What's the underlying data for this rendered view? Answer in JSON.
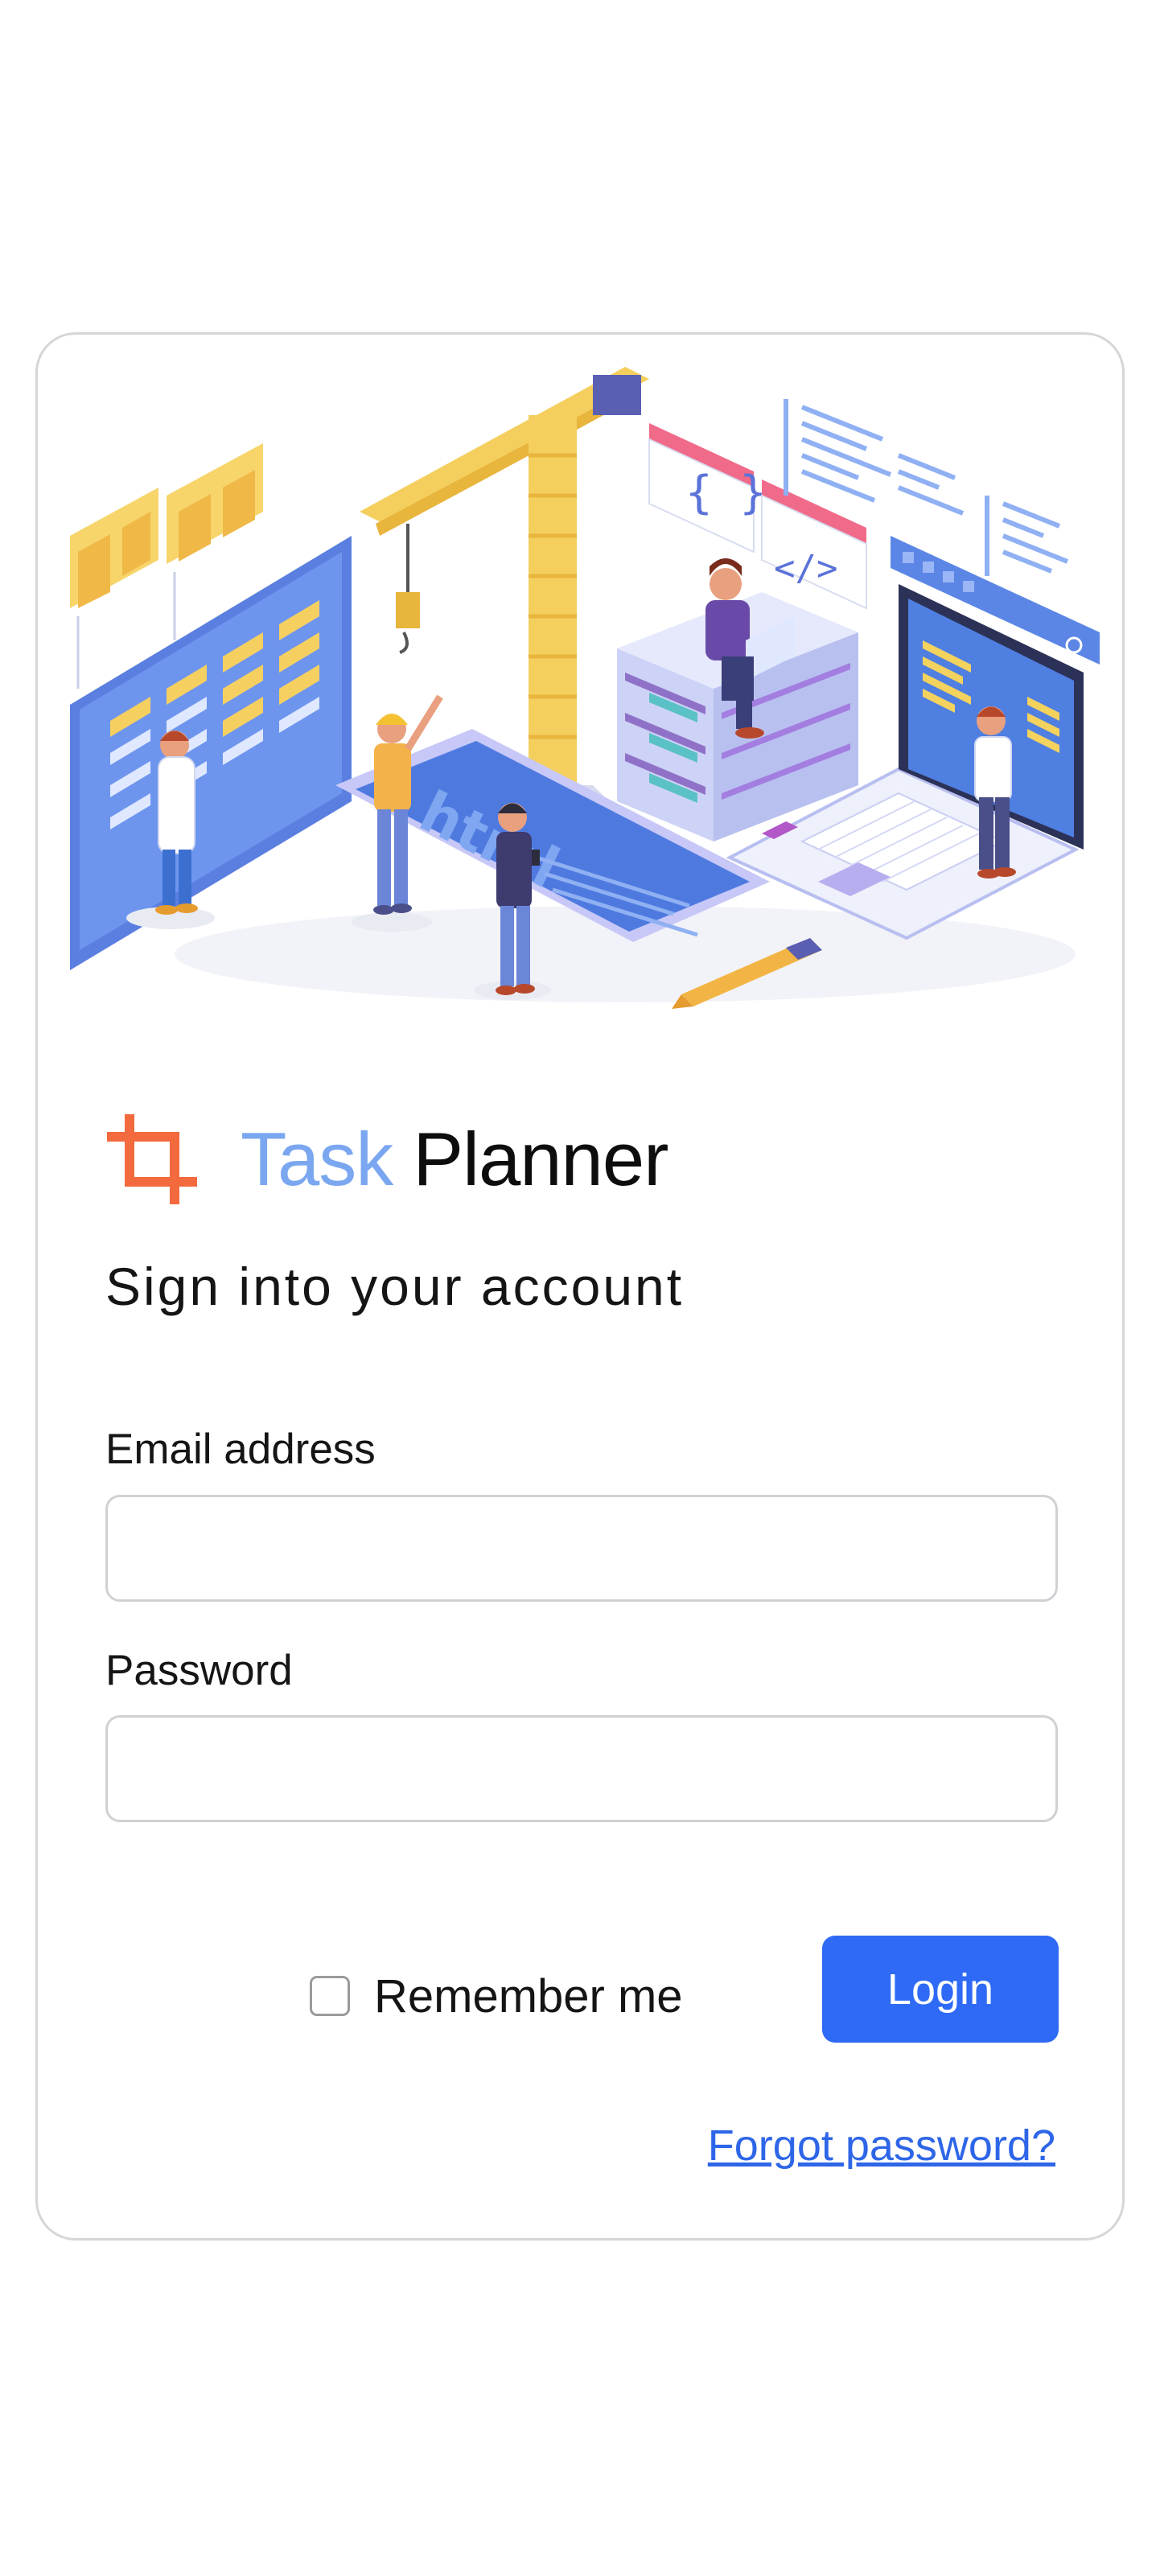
{
  "brand": {
    "name_part1": "Task",
    "name_part2": "Planner"
  },
  "login_form": {
    "heading": "Sign into your account",
    "email_label": "Email address",
    "email_value": "",
    "password_label": "Password",
    "password_value": "",
    "remember_label": "Remember me",
    "remember_checked": false,
    "login_label": "Login",
    "forgot_label": "Forgot password?"
  },
  "illustration": {
    "code_badge_1": "{ }",
    "code_badge_2": "</>",
    "floor_text": "html"
  },
  "colors": {
    "brand_task": "#7aa7f0",
    "brand_planner": "#0d0d0d",
    "logo": "#f26a3d",
    "primary_button": "#2e6af5",
    "link": "#2e66e8",
    "card_border": "#d6d6d8"
  },
  "icons": {
    "logo": "crop-icon",
    "checkbox": "checkbox-icon",
    "screen_search": "search-icon"
  }
}
